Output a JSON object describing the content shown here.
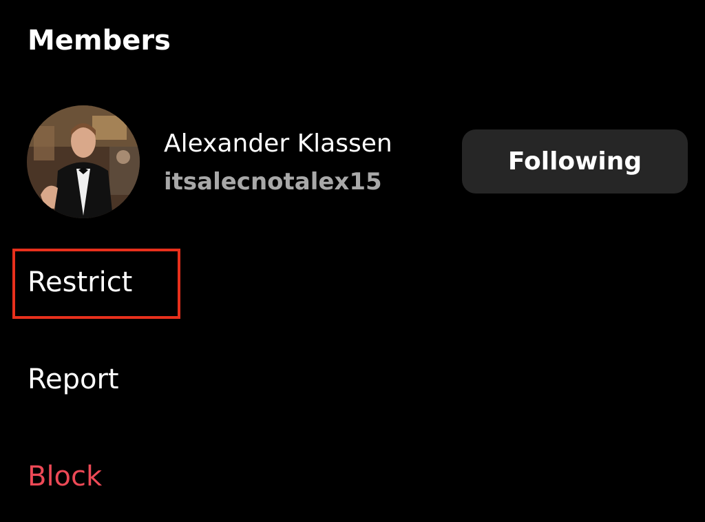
{
  "section": {
    "title": "Members"
  },
  "member": {
    "name": "Alexander Klassen",
    "username": "itsalecnotalex15",
    "follow_label": "Following",
    "avatar_icon": "profile-photo"
  },
  "actions": {
    "restrict": "Restrict",
    "report": "Report",
    "block": "Block"
  },
  "colors": {
    "background": "#000000",
    "button_bg": "#262626",
    "block_red": "#ed4956",
    "highlight": "#e8301c",
    "secondary_text": "#a8a8a8"
  }
}
